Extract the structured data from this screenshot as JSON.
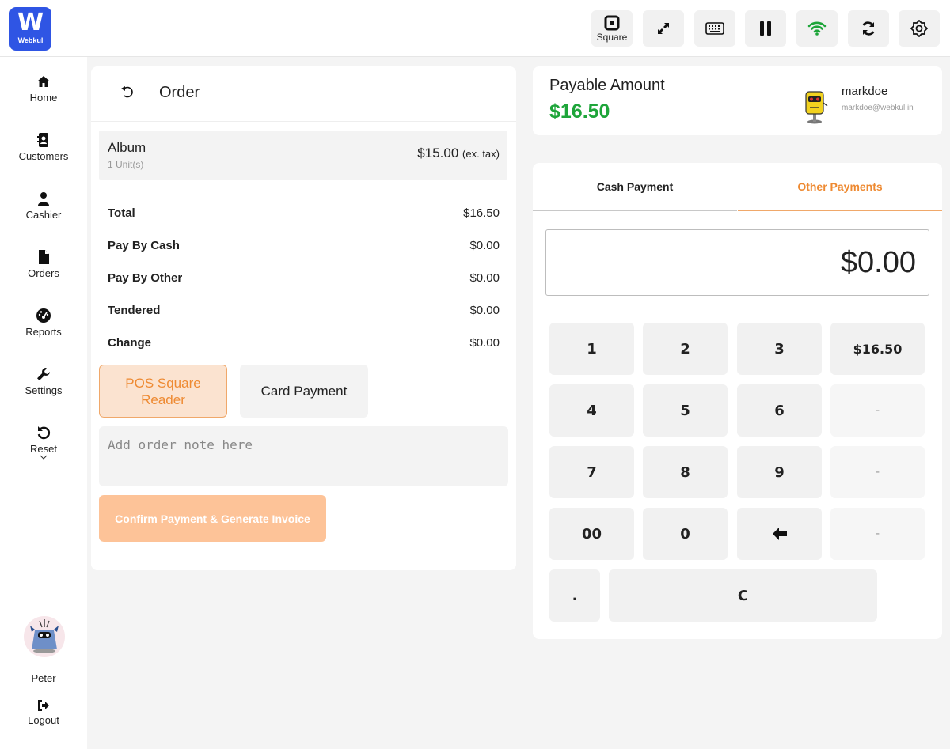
{
  "brand": {
    "logo_letter": "W",
    "logo_text": "Webkul",
    "color": "#2f55e4"
  },
  "topbar": {
    "buttons": [
      {
        "icon": "square-reader-icon",
        "label": "Square"
      },
      {
        "icon": "fullscreen-icon"
      },
      {
        "icon": "keyboard-icon"
      },
      {
        "icon": "pause-icon"
      },
      {
        "icon": "wifi-icon",
        "color": "#1ea53a"
      },
      {
        "icon": "sync-icon"
      },
      {
        "icon": "brightness-icon"
      }
    ]
  },
  "sidebar": {
    "items": [
      {
        "label": "Home",
        "icon": "home-icon"
      },
      {
        "label": "Customers",
        "icon": "address-book-icon"
      },
      {
        "label": "Cashier",
        "icon": "user-icon"
      },
      {
        "label": "Orders",
        "icon": "file-icon"
      },
      {
        "label": "Reports",
        "icon": "dashboard-icon"
      },
      {
        "label": "Settings",
        "icon": "wrench-icon"
      },
      {
        "label": "Reset",
        "icon": "reset-icon"
      }
    ],
    "user": {
      "name": "Peter"
    },
    "logout_label": "Logout"
  },
  "order": {
    "title": "Order",
    "item": {
      "name": "Album",
      "units": "1 Unit(s)",
      "price": "$15.00",
      "tax_note": "(ex. tax)"
    },
    "summary": [
      {
        "label": "Total",
        "value": "$16.50"
      },
      {
        "label": "Pay By Cash",
        "value": "$0.00"
      },
      {
        "label": "Pay By Other",
        "value": "$0.00"
      },
      {
        "label": "Tendered",
        "value": "$0.00"
      },
      {
        "label": "Change",
        "value": "$0.00"
      }
    ],
    "payment_options": {
      "square": "POS Square Reader",
      "card": "Card Payment"
    },
    "note_placeholder": "Add order note here",
    "confirm_label": "Confirm Payment & Generate Invoice"
  },
  "payable": {
    "label": "Payable Amount",
    "amount": "$16.50",
    "user_name": "markdoe",
    "user_email": "markdoe@webkul.in"
  },
  "payment": {
    "tabs": {
      "cash": "Cash Payment",
      "other": "Other Payments"
    },
    "active_tab": "Other Payments",
    "display": "$0.00",
    "keys": {
      "k1": "1",
      "k2": "2",
      "k3": "3",
      "amount": "$16.50",
      "k4": "4",
      "k5": "5",
      "k6": "6",
      "d1": "-",
      "k7": "7",
      "k8": "8",
      "k9": "9",
      "d2": "-",
      "k00": "00",
      "k0": "0",
      "d3": "-",
      "dot": ".",
      "clear": "C"
    }
  },
  "colors": {
    "accent": "#ee8a32",
    "positive": "#1ea53a"
  }
}
